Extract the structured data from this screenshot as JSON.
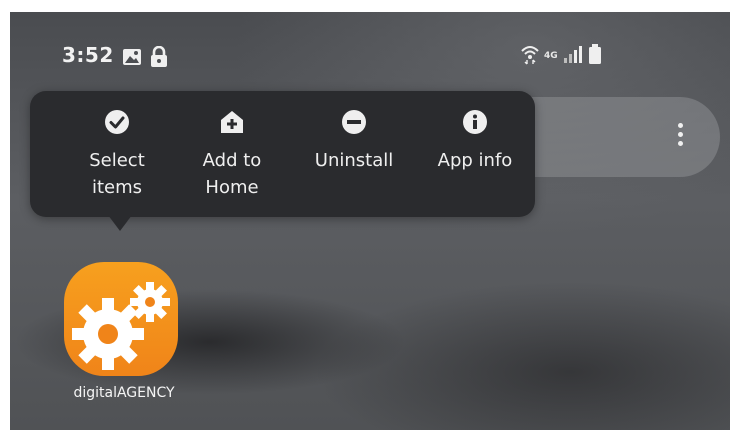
{
  "status_bar": {
    "time": "3:52",
    "left_icons": [
      "image-icon",
      "lock-icon"
    ],
    "right_icons": [
      "wifi-icon",
      "signal-icon",
      "battery-icon"
    ],
    "network_type": "4G"
  },
  "popup_menu": {
    "items": [
      {
        "label": "Select\nitems",
        "icon": "check-circle-icon"
      },
      {
        "label": "Add to\nHome",
        "icon": "add-home-icon"
      },
      {
        "label": "Uninstall",
        "icon": "minus-circle-icon"
      },
      {
        "label": "App info",
        "icon": "info-circle-icon"
      }
    ]
  },
  "search_bar": {
    "menu_icon": "more-vert-icon"
  },
  "app": {
    "name": "digitalAGENCY",
    "icon": "gears-icon"
  },
  "colors": {
    "popup_bg": "#2a2b2e",
    "app_icon_orange": "#f08419",
    "text": "#efefef"
  }
}
